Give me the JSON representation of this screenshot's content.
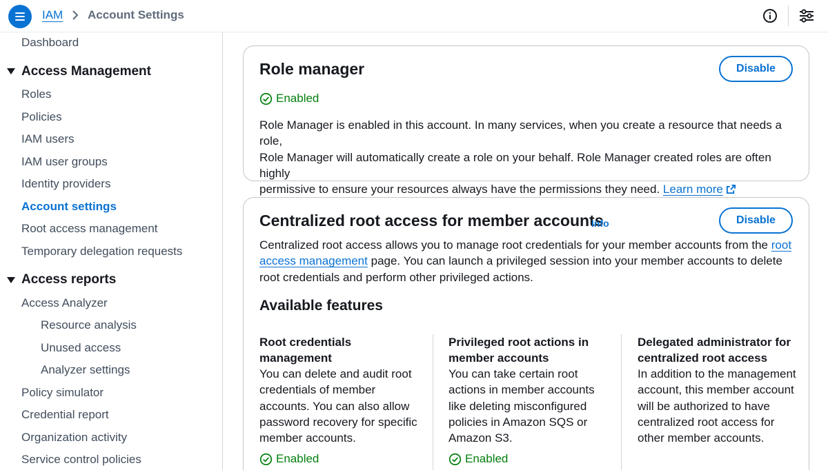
{
  "header": {
    "breadcrumb_root": "IAM",
    "breadcrumb_current": "Account Settings"
  },
  "sidebar": {
    "dashboard": "Dashboard",
    "access_management": {
      "label": "Access Management",
      "items": [
        "Roles",
        "Policies",
        "IAM users",
        "IAM user groups",
        "Identity providers",
        "Account settings",
        "Root access management",
        "Temporary delegation requests"
      ]
    },
    "access_reports": {
      "label": "Access reports",
      "items": [
        "Access Analyzer",
        "Resource analysis",
        "Unused access",
        "Analyzer settings",
        "Policy simulator",
        "Credential report",
        "Organization activity",
        "Service control policies"
      ]
    }
  },
  "role_manager": {
    "title": "Role manager",
    "button": "Disable",
    "status": "Enabled",
    "desc_line1": "Role Manager is enabled in this account. In many services, when you create a resource that needs a role,",
    "desc_line2": "Role Manager will automatically create a role on your behalf. Role Manager created roles are often highly",
    "desc_line3": "permissive to ensure your resources always have the permissions they need.",
    "learn_more": "Learn more"
  },
  "centralized": {
    "title": "Centralized root access for member accounts",
    "info": "Info",
    "button": "Disable",
    "desc_part1": "Centralized root access allows you to manage root credentials for your member accounts from the",
    "desc_link": "root access management",
    "desc_part2": "page. You can launch a privileged session into your member accounts to delete root credentials and perform other privileged actions.",
    "features_heading": "Available features",
    "features": [
      {
        "title": "Root credentials management",
        "desc": "You can delete and audit root credentials of member accounts. You can also allow password recovery for specific member accounts.",
        "status": "Enabled"
      },
      {
        "title": "Privileged root actions in member accounts",
        "desc": "You can take certain root actions in member accounts like deleting misconfigured policies in Amazon SQS or Amazon S3.",
        "status": "Enabled"
      },
      {
        "title": "Delegated administrator for centralized root access",
        "desc": "In addition to the management account, this member account will be authorized to have centralized root access for other member accounts."
      }
    ]
  },
  "icons": {
    "menu": "hamburger-menu-icon",
    "info": "info-circle-icon",
    "settings": "sliders-icon",
    "status": "check-circle-icon",
    "external": "external-link-icon"
  },
  "colors": {
    "link": "#0972d3",
    "success": "#037f0c",
    "text": "#16191f"
  }
}
